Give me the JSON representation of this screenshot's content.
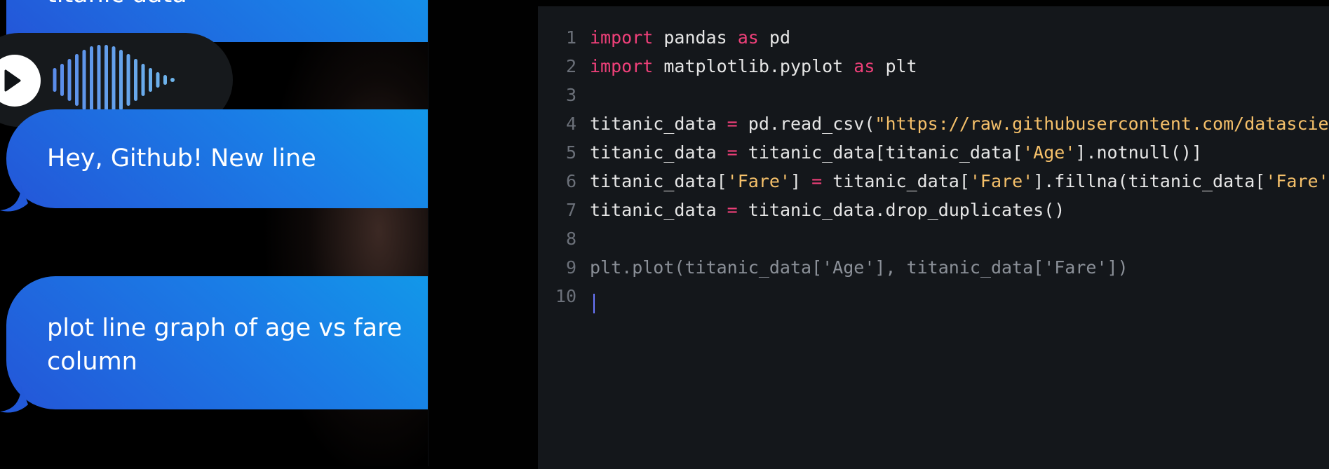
{
  "chat": {
    "messages": [
      {
        "text": "titanic data"
      },
      {
        "text": "Hey, Github! New line"
      },
      {
        "text": "plot line graph of age vs fare column"
      }
    ],
    "audio": {
      "play_icon": "play-icon",
      "waveform_icon": "waveform-icon"
    }
  },
  "editor": {
    "lines": [
      {
        "num": "1",
        "tokens": [
          {
            "t": "import",
            "c": "kw"
          },
          {
            "t": " pandas ",
            "c": ""
          },
          {
            "t": "as",
            "c": "kw"
          },
          {
            "t": " pd",
            "c": ""
          }
        ]
      },
      {
        "num": "2",
        "tokens": [
          {
            "t": "import",
            "c": "kw"
          },
          {
            "t": " matplotlib.pyplot ",
            "c": ""
          },
          {
            "t": "as",
            "c": "kw"
          },
          {
            "t": " plt",
            "c": ""
          }
        ]
      },
      {
        "num": "3",
        "tokens": []
      },
      {
        "num": "4",
        "tokens": [
          {
            "t": "titanic_data ",
            "c": ""
          },
          {
            "t": "=",
            "c": "op"
          },
          {
            "t": " pd.read_csv(",
            "c": ""
          },
          {
            "t": "\"https://raw.githubusercontent.com/datascien",
            "c": "str"
          }
        ]
      },
      {
        "num": "5",
        "tokens": [
          {
            "t": "titanic_data ",
            "c": ""
          },
          {
            "t": "=",
            "c": "op"
          },
          {
            "t": " titanic_data[titanic_data[",
            "c": ""
          },
          {
            "t": "'Age'",
            "c": "str"
          },
          {
            "t": "].notnull()]",
            "c": ""
          }
        ]
      },
      {
        "num": "6",
        "tokens": [
          {
            "t": "titanic_data[",
            "c": ""
          },
          {
            "t": "'Fare'",
            "c": "str"
          },
          {
            "t": "] ",
            "c": ""
          },
          {
            "t": "=",
            "c": "op"
          },
          {
            "t": " titanic_data[",
            "c": ""
          },
          {
            "t": "'Fare'",
            "c": "str"
          },
          {
            "t": "].fillna(titanic_data[",
            "c": ""
          },
          {
            "t": "'Fare'",
            "c": "str"
          },
          {
            "t": "]",
            "c": ""
          }
        ]
      },
      {
        "num": "7",
        "tokens": [
          {
            "t": "titanic_data ",
            "c": ""
          },
          {
            "t": "=",
            "c": "op"
          },
          {
            "t": " titanic_data.drop_duplicates()",
            "c": ""
          }
        ]
      },
      {
        "num": "8",
        "tokens": []
      },
      {
        "num": "9",
        "tokens": [
          {
            "t": "plt.plot(titanic_data['Age'], titanic_data['Fare'])",
            "c": "ghost"
          }
        ]
      },
      {
        "num": "10",
        "tokens": []
      }
    ]
  },
  "colors": {
    "bubble_start": "#2456d8",
    "bubble_end": "#0fa2ea",
    "keyword": "#f0407a",
    "string": "#f5c06a",
    "suggestion": "#8b9098",
    "cursor": "#6b78ff"
  }
}
